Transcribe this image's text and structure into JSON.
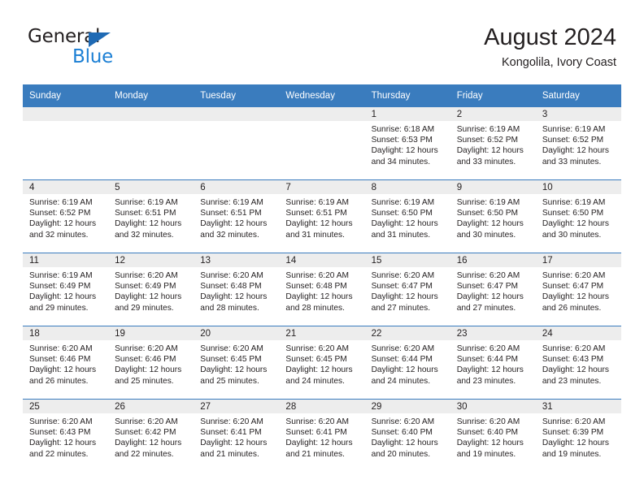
{
  "brand": {
    "name_part1": "General",
    "name_part2": "Blue",
    "accent_color": "#1b7fd4",
    "triangle_color": "#1f6ab4"
  },
  "header": {
    "title": "August 2024",
    "subtitle": "Kongolila, Ivory Coast"
  },
  "calendar": {
    "header_bg": "#3a7cbe",
    "date_band_bg": "#ededed",
    "weekdays": [
      "Sunday",
      "Monday",
      "Tuesday",
      "Wednesday",
      "Thursday",
      "Friday",
      "Saturday"
    ],
    "labels": {
      "sunrise": "Sunrise:",
      "sunset": "Sunset:",
      "daylight": "Daylight:"
    },
    "weeks": [
      [
        {
          "day": "",
          "sunrise": "",
          "sunset": "",
          "daylight_line1": "",
          "daylight_line2": ""
        },
        {
          "day": "",
          "sunrise": "",
          "sunset": "",
          "daylight_line1": "",
          "daylight_line2": ""
        },
        {
          "day": "",
          "sunrise": "",
          "sunset": "",
          "daylight_line1": "",
          "daylight_line2": ""
        },
        {
          "day": "",
          "sunrise": "",
          "sunset": "",
          "daylight_line1": "",
          "daylight_line2": ""
        },
        {
          "day": "1",
          "sunrise": "Sunrise: 6:18 AM",
          "sunset": "Sunset: 6:53 PM",
          "daylight_line1": "Daylight: 12 hours",
          "daylight_line2": "and 34 minutes."
        },
        {
          "day": "2",
          "sunrise": "Sunrise: 6:19 AM",
          "sunset": "Sunset: 6:52 PM",
          "daylight_line1": "Daylight: 12 hours",
          "daylight_line2": "and 33 minutes."
        },
        {
          "day": "3",
          "sunrise": "Sunrise: 6:19 AM",
          "sunset": "Sunset: 6:52 PM",
          "daylight_line1": "Daylight: 12 hours",
          "daylight_line2": "and 33 minutes."
        }
      ],
      [
        {
          "day": "4",
          "sunrise": "Sunrise: 6:19 AM",
          "sunset": "Sunset: 6:52 PM",
          "daylight_line1": "Daylight: 12 hours",
          "daylight_line2": "and 32 minutes."
        },
        {
          "day": "5",
          "sunrise": "Sunrise: 6:19 AM",
          "sunset": "Sunset: 6:51 PM",
          "daylight_line1": "Daylight: 12 hours",
          "daylight_line2": "and 32 minutes."
        },
        {
          "day": "6",
          "sunrise": "Sunrise: 6:19 AM",
          "sunset": "Sunset: 6:51 PM",
          "daylight_line1": "Daylight: 12 hours",
          "daylight_line2": "and 32 minutes."
        },
        {
          "day": "7",
          "sunrise": "Sunrise: 6:19 AM",
          "sunset": "Sunset: 6:51 PM",
          "daylight_line1": "Daylight: 12 hours",
          "daylight_line2": "and 31 minutes."
        },
        {
          "day": "8",
          "sunrise": "Sunrise: 6:19 AM",
          "sunset": "Sunset: 6:50 PM",
          "daylight_line1": "Daylight: 12 hours",
          "daylight_line2": "and 31 minutes."
        },
        {
          "day": "9",
          "sunrise": "Sunrise: 6:19 AM",
          "sunset": "Sunset: 6:50 PM",
          "daylight_line1": "Daylight: 12 hours",
          "daylight_line2": "and 30 minutes."
        },
        {
          "day": "10",
          "sunrise": "Sunrise: 6:19 AM",
          "sunset": "Sunset: 6:50 PM",
          "daylight_line1": "Daylight: 12 hours",
          "daylight_line2": "and 30 minutes."
        }
      ],
      [
        {
          "day": "11",
          "sunrise": "Sunrise: 6:19 AM",
          "sunset": "Sunset: 6:49 PM",
          "daylight_line1": "Daylight: 12 hours",
          "daylight_line2": "and 29 minutes."
        },
        {
          "day": "12",
          "sunrise": "Sunrise: 6:20 AM",
          "sunset": "Sunset: 6:49 PM",
          "daylight_line1": "Daylight: 12 hours",
          "daylight_line2": "and 29 minutes."
        },
        {
          "day": "13",
          "sunrise": "Sunrise: 6:20 AM",
          "sunset": "Sunset: 6:48 PM",
          "daylight_line1": "Daylight: 12 hours",
          "daylight_line2": "and 28 minutes."
        },
        {
          "day": "14",
          "sunrise": "Sunrise: 6:20 AM",
          "sunset": "Sunset: 6:48 PM",
          "daylight_line1": "Daylight: 12 hours",
          "daylight_line2": "and 28 minutes."
        },
        {
          "day": "15",
          "sunrise": "Sunrise: 6:20 AM",
          "sunset": "Sunset: 6:47 PM",
          "daylight_line1": "Daylight: 12 hours",
          "daylight_line2": "and 27 minutes."
        },
        {
          "day": "16",
          "sunrise": "Sunrise: 6:20 AM",
          "sunset": "Sunset: 6:47 PM",
          "daylight_line1": "Daylight: 12 hours",
          "daylight_line2": "and 27 minutes."
        },
        {
          "day": "17",
          "sunrise": "Sunrise: 6:20 AM",
          "sunset": "Sunset: 6:47 PM",
          "daylight_line1": "Daylight: 12 hours",
          "daylight_line2": "and 26 minutes."
        }
      ],
      [
        {
          "day": "18",
          "sunrise": "Sunrise: 6:20 AM",
          "sunset": "Sunset: 6:46 PM",
          "daylight_line1": "Daylight: 12 hours",
          "daylight_line2": "and 26 minutes."
        },
        {
          "day": "19",
          "sunrise": "Sunrise: 6:20 AM",
          "sunset": "Sunset: 6:46 PM",
          "daylight_line1": "Daylight: 12 hours",
          "daylight_line2": "and 25 minutes."
        },
        {
          "day": "20",
          "sunrise": "Sunrise: 6:20 AM",
          "sunset": "Sunset: 6:45 PM",
          "daylight_line1": "Daylight: 12 hours",
          "daylight_line2": "and 25 minutes."
        },
        {
          "day": "21",
          "sunrise": "Sunrise: 6:20 AM",
          "sunset": "Sunset: 6:45 PM",
          "daylight_line1": "Daylight: 12 hours",
          "daylight_line2": "and 24 minutes."
        },
        {
          "day": "22",
          "sunrise": "Sunrise: 6:20 AM",
          "sunset": "Sunset: 6:44 PM",
          "daylight_line1": "Daylight: 12 hours",
          "daylight_line2": "and 24 minutes."
        },
        {
          "day": "23",
          "sunrise": "Sunrise: 6:20 AM",
          "sunset": "Sunset: 6:44 PM",
          "daylight_line1": "Daylight: 12 hours",
          "daylight_line2": "and 23 minutes."
        },
        {
          "day": "24",
          "sunrise": "Sunrise: 6:20 AM",
          "sunset": "Sunset: 6:43 PM",
          "daylight_line1": "Daylight: 12 hours",
          "daylight_line2": "and 23 minutes."
        }
      ],
      [
        {
          "day": "25",
          "sunrise": "Sunrise: 6:20 AM",
          "sunset": "Sunset: 6:43 PM",
          "daylight_line1": "Daylight: 12 hours",
          "daylight_line2": "and 22 minutes."
        },
        {
          "day": "26",
          "sunrise": "Sunrise: 6:20 AM",
          "sunset": "Sunset: 6:42 PM",
          "daylight_line1": "Daylight: 12 hours",
          "daylight_line2": "and 22 minutes."
        },
        {
          "day": "27",
          "sunrise": "Sunrise: 6:20 AM",
          "sunset": "Sunset: 6:41 PM",
          "daylight_line1": "Daylight: 12 hours",
          "daylight_line2": "and 21 minutes."
        },
        {
          "day": "28",
          "sunrise": "Sunrise: 6:20 AM",
          "sunset": "Sunset: 6:41 PM",
          "daylight_line1": "Daylight: 12 hours",
          "daylight_line2": "and 21 minutes."
        },
        {
          "day": "29",
          "sunrise": "Sunrise: 6:20 AM",
          "sunset": "Sunset: 6:40 PM",
          "daylight_line1": "Daylight: 12 hours",
          "daylight_line2": "and 20 minutes."
        },
        {
          "day": "30",
          "sunrise": "Sunrise: 6:20 AM",
          "sunset": "Sunset: 6:40 PM",
          "daylight_line1": "Daylight: 12 hours",
          "daylight_line2": "and 19 minutes."
        },
        {
          "day": "31",
          "sunrise": "Sunrise: 6:20 AM",
          "sunset": "Sunset: 6:39 PM",
          "daylight_line1": "Daylight: 12 hours",
          "daylight_line2": "and 19 minutes."
        }
      ]
    ]
  }
}
